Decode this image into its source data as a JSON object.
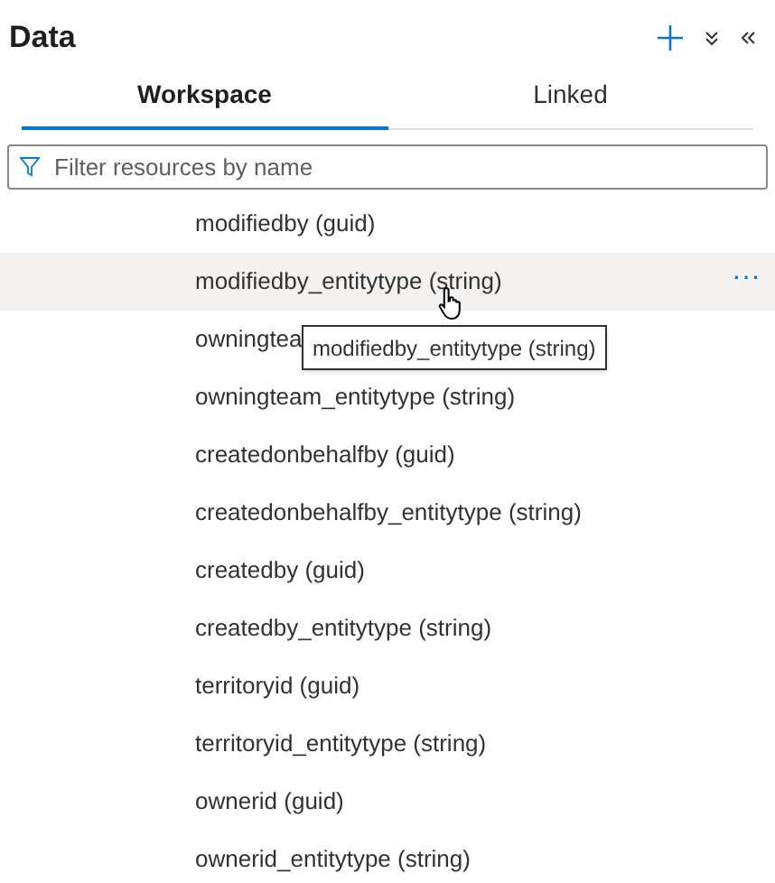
{
  "title": "Data",
  "tabs": [
    {
      "label": "Workspace",
      "selected": true
    },
    {
      "label": "Linked",
      "selected": false
    }
  ],
  "filter": {
    "placeholder": "Filter resources by name"
  },
  "items": [
    {
      "label": "modifiedby (guid)",
      "highlighted": false
    },
    {
      "label": "modifiedby_entitytype (string)",
      "highlighted": true
    },
    {
      "label": "owningtea",
      "highlighted": false
    },
    {
      "label": "owningteam_entitytype (string)",
      "highlighted": false
    },
    {
      "label": "createdonbehalfby (guid)",
      "highlighted": false
    },
    {
      "label": "createdonbehalfby_entitytype (string)",
      "highlighted": false
    },
    {
      "label": "createdby (guid)",
      "highlighted": false
    },
    {
      "label": "createdby_entitytype (string)",
      "highlighted": false
    },
    {
      "label": "territoryid (guid)",
      "highlighted": false
    },
    {
      "label": "territoryid_entitytype (string)",
      "highlighted": false
    },
    {
      "label": "ownerid (guid)",
      "highlighted": false
    },
    {
      "label": "ownerid_entitytype (string)",
      "highlighted": false
    }
  ],
  "more_button": "···",
  "tooltip": "modifiedby_entitytype (string)"
}
